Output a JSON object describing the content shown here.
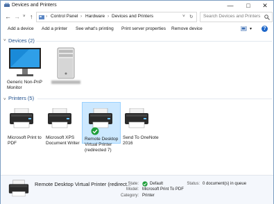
{
  "window": {
    "title": "Devices and Printers"
  },
  "nav": {
    "breadcrumb": [
      "Control Panel",
      "Hardware",
      "Devices and Printers"
    ],
    "search_placeholder": "Search Devices and Printers"
  },
  "toolbar": {
    "add_device": "Add a device",
    "add_printer": "Add a printer",
    "see_printing": "See what's printing",
    "server_props": "Print server properties",
    "remove_device": "Remove device",
    "help": "?"
  },
  "devices": {
    "heading": "Devices (2)",
    "items": [
      {
        "label_line1": "Generic Non-PnP",
        "label_line2": "Monitor",
        "icon": "monitor-icon"
      },
      {
        "label_line1": "",
        "label_line2": "",
        "icon": "computer-tower-icon",
        "blurred": true
      }
    ]
  },
  "printers": {
    "heading": "Printers (5)",
    "items": [
      {
        "line1": "Microsoft Print to",
        "line2": "PDF",
        "line3": "",
        "line4": ""
      },
      {
        "line1": "Microsoft XPS",
        "line2": "Document Writer",
        "line3": "",
        "line4": ""
      },
      {
        "line1": "Remote Desktop",
        "line2": "Virtual Printer",
        "line3": "(redirected 7)",
        "line4": "",
        "selected": true,
        "default": true
      },
      {
        "line1": "Send To OneNote",
        "line2": "2016",
        "line3": "",
        "line4": ""
      }
    ]
  },
  "details": {
    "name": "Remote Desktop Virtual Printer (redirect...",
    "state_label": "State:",
    "state_value": "Default",
    "model_label": "Model:",
    "model_value": "Microsoft Print To PDF",
    "category_label": "Category:",
    "category_value": "Printer",
    "status_label": "Status:",
    "status_value": "0 document(s) in queue"
  },
  "colors": {
    "accent": "#1e4e8c",
    "selected_bg": "#cce8ff",
    "default_check": "#1e9e3a"
  }
}
